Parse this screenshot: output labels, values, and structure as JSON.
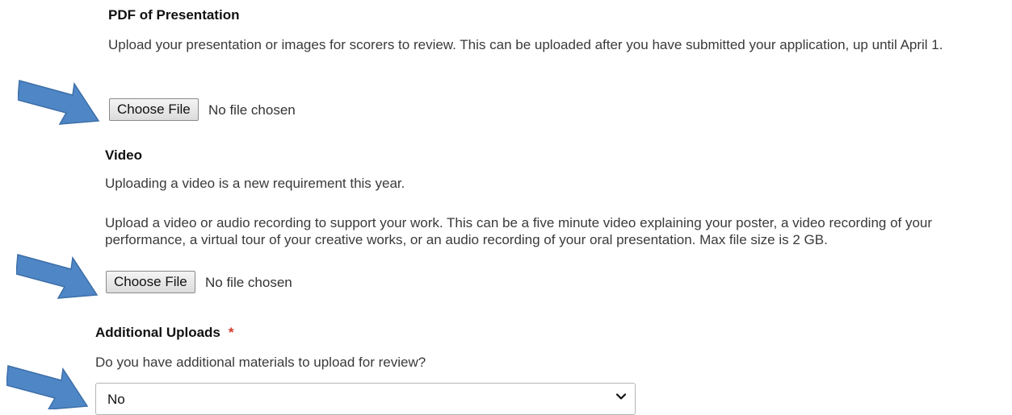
{
  "pdf_section": {
    "title": "PDF of Presentation",
    "description": "Upload your presentation or images for scorers to review. This can be uploaded after you have submitted your application, up until April 1.",
    "button_label": "Choose File",
    "file_status": "No file chosen"
  },
  "video_section": {
    "title": "Video",
    "note": "Uploading a video is a new requirement this year.",
    "description": "Upload a video or audio recording to support your work.  This can be a five minute video explaining your poster, a video recording of your performance, a virtual tour of your creative works, or an audio recording of your oral presentation.  Max file size is 2 GB.",
    "button_label": "Choose File",
    "file_status": "No file chosen"
  },
  "additional_section": {
    "title": "Additional Uploads",
    "required_marker": "*",
    "question": "Do you have additional materials to upload for review?",
    "selected_value": "No"
  },
  "annotations": {
    "arrow_color": "#4f86c6",
    "arrow_icon": "right-arrow-callout"
  }
}
